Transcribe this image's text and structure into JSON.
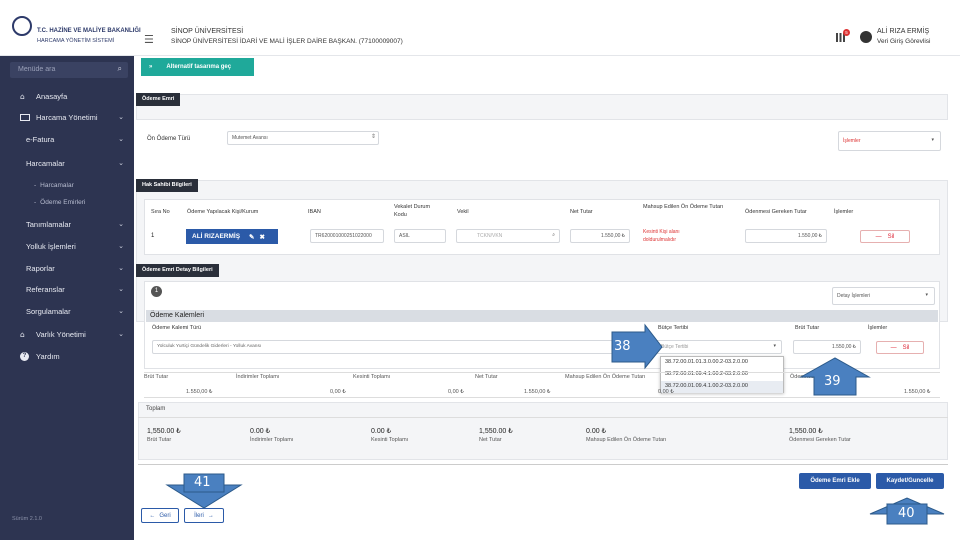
{
  "header": {
    "logo_line1": "T.C. HAZİNE VE MALİYE BAKANLIĞI",
    "logo_line2": "HARCAMA YÖNETİM SİSTEMİ",
    "org_line1": "SİNOP ÜNİVERSİTESİ",
    "org_line2": "SİNOP ÜNİVERSİTESİ İDARİ VE MALİ İŞLER DAİRE BAŞKAN. (77100009007)",
    "notif_count": "5",
    "user_name": "ALİ RIZA ERMİŞ",
    "user_role": "Veri Giriş Görevlisi"
  },
  "sidebar": {
    "search_placeholder": "Menüde ara",
    "items": [
      {
        "label": "Anasayfa"
      },
      {
        "label": "Harcama Yönetimi"
      },
      {
        "label": "e-Fatura"
      },
      {
        "label": "Harcamalar"
      },
      {
        "label": "Harcamalar"
      },
      {
        "label": "Ödeme Emirleri"
      },
      {
        "label": "Tanımlamalar"
      },
      {
        "label": "Yolluk İşlemleri"
      },
      {
        "label": "Raporlar"
      },
      {
        "label": "Referanslar"
      },
      {
        "label": "Sorgulamalar"
      },
      {
        "label": "Varlık Yönetimi"
      },
      {
        "label": "Yardım"
      }
    ],
    "version": "Sürüm 2.1.0"
  },
  "main": {
    "alt_screen_button": "Alternatif tasarıma geç",
    "odeme_emri_header": "Ödeme Emri",
    "on_odeme_label": "Ön Ödeme Türü",
    "on_odeme_value": "Mutemet Avansı",
    "islemler_select": "İşlemler",
    "hak_sahibi_header": "Hak Sahibi Bilgileri",
    "hak_cols": [
      "Sıra No",
      "Ödeme Yapılacak Kişi/Kurum",
      "IBAN",
      "Vekalet Durum Kodu",
      "Vekil",
      "Net Tutar",
      "Mahsup Edilen Ön Ödeme Tutarı",
      "Ödenmesi Gereken Tutar",
      "İşlemler"
    ],
    "hak_row": {
      "sira": "1",
      "kisi": "ALİ RIZAERMİŞ",
      "iban": "TR620001000251022000",
      "vekalet": "ASIL",
      "vekil_placeholder": "TCKN/VKN",
      "net": "1.550,00 ₺",
      "mahsup_note1": "Kesinti Kişi alanı",
      "mahsup_note2": "doldurulmalıdır",
      "odenmesi": "1.550,00 ₺",
      "sil": "Sil"
    },
    "detay_header": "Ödeme Emri Detay Bilgileri",
    "detay_index": "1",
    "detay_islemleri": "Detay İşlemleri",
    "kalem_title": "Ödeme Kalemleri",
    "kalem_cols": [
      "Ödeme Kalemi Türü",
      "Bütçe Tertibi",
      "Brüt Tutar",
      "İşlemler"
    ],
    "kalem_value": "Yolculuk Yurtiçi Gündelik Giderleri - Yolluk Avansı",
    "butce_placeholder": "Bütçe Tertibi",
    "brut": "1.550,00 ₺",
    "kalem_sil": "Sil",
    "dropdown_items": [
      "38.72.00.01.01.3.0.00.2-03.2.0.00",
      "38.72.00.01.09.4.1.00.2-03.2.0.00",
      "38.72.00.01.09.4.1.00.2-03.2.0.00"
    ],
    "sum_cols": [
      "Brüt Tutar",
      "İndirimler Toplamı",
      "Kesinti Toplamı",
      "Net Tutar",
      "Mahsup Edilen Ön Ödeme Tutarı",
      "Ödenmesi Gereken Tutar"
    ],
    "sum_vals": [
      "1.550,00 ₺",
      "0,00 ₺",
      "0,00 ₺",
      "1.550,00 ₺",
      "0,00 ₺",
      "1.550,00 ₺"
    ],
    "toplam_header": "Toplam",
    "toplam": [
      {
        "value": "1,550.00 ₺",
        "label": "Brüt Tutar"
      },
      {
        "value": "0.00 ₺",
        "label": "İndirimler Toplamı"
      },
      {
        "value": "0.00 ₺",
        "label": "Kesinti Toplamı"
      },
      {
        "value": "1,550.00 ₺",
        "label": "Net Tutar"
      },
      {
        "value": "0.00 ₺",
        "label": "Mahsup Edilen Ön Ödeme Tutarı"
      },
      {
        "value": "1,550.00 ₺",
        "label": "Ödenmesi Gereken Tutar"
      }
    ],
    "btn_odeme_ekle": "Ödeme Emri Ekle",
    "btn_kaydet": "Kaydet/Guncelle",
    "btn_geri": "Geri",
    "btn_ileri": "İleri"
  },
  "callouts": [
    "38",
    "39",
    "40",
    "41"
  ]
}
